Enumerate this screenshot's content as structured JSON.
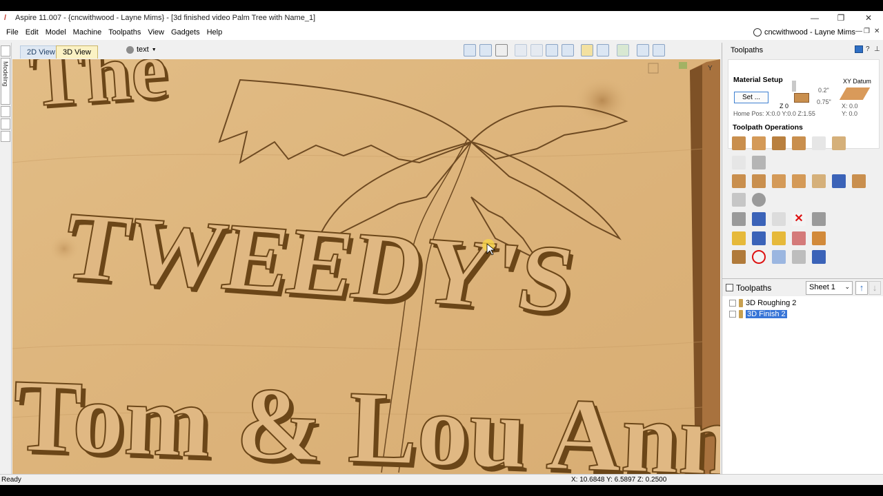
{
  "window": {
    "app_name": "Aspire 11.007",
    "title": "Aspire 11.007 - {cncwithwood - Layne Mims} - [3d finished video Palm Tree with Name_1]",
    "minimize": "—",
    "maximize": "❐",
    "close": "✕"
  },
  "menu": {
    "items": [
      "File",
      "Edit",
      "Model",
      "Machine",
      "Toolpaths",
      "View",
      "Gadgets",
      "Help"
    ],
    "user": "cncwithwood - Layne Mims"
  },
  "left_strip": {
    "tab_label": "Modeling"
  },
  "view_tabs": {
    "tab_2d": "2D View",
    "tab_3d": "3D View",
    "layer": "text"
  },
  "viewport": {
    "carved_words": {
      "line1": "The",
      "line2": "TWEEDY'S",
      "line3": "Tom & Lou Ann"
    },
    "axis_label": "Y"
  },
  "status": {
    "ready": "Ready",
    "coords": "X: 10.6848 Y:   6.5897 Z:   0.2500"
  },
  "panel": {
    "title": "Toolpaths",
    "material_setup": {
      "heading": "Material Setup",
      "set_button": "Set ...",
      "top_value": "0.2\"",
      "thickness": "0.75\"",
      "z_label": "Z 0",
      "home_pos": "Home Pos:   X:0.0 Y:0.0 Z:1.55",
      "xy_datum": "XY Datum",
      "datum_x": "X: 0.0",
      "datum_y": "Y: 0.0"
    },
    "operations_heading": "Toolpath Operations",
    "toolpaths_label": "Toolpaths",
    "sheet_select": "Sheet 1",
    "toolpath_list": [
      "3D Roughing 2",
      "3D Finish 2"
    ]
  },
  "colors": {
    "wood": "#d9b07a",
    "selection": "#3875d7",
    "active_tab": "#fbf2c4"
  }
}
